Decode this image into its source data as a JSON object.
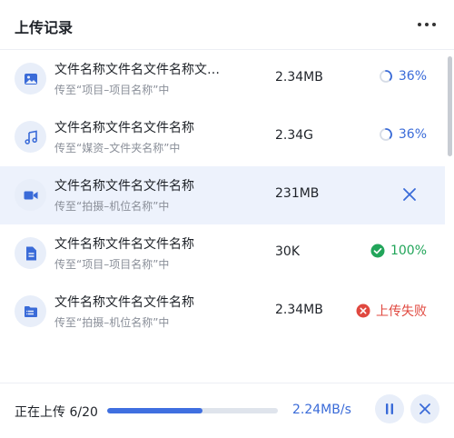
{
  "header": {
    "title": "上传记录",
    "menu_icon": "more-horizontal-icon"
  },
  "files": [
    {
      "name": "文件名称文件名文件名称文…",
      "dest": "传至“项目–项目名称”中",
      "size": "2.34MB",
      "type_icon": "image-icon",
      "state": "uploading",
      "status_text": "36%",
      "progress": 0.36
    },
    {
      "name": "文件名称文件名文件名称",
      "dest": "传至“媒资–文件夹名称”中",
      "size": "2.34G",
      "type_icon": "music-icon",
      "state": "uploading",
      "status_text": "36%",
      "progress": 0.36
    },
    {
      "name": "文件名称文件名文件名称",
      "dest": "传至“拍摄–机位名称”中",
      "size": "231MB",
      "type_icon": "video-icon",
      "state": "selected",
      "status_text": ""
    },
    {
      "name": "文件名称文件名文件名称",
      "dest": "传至“项目–项目名称”中",
      "size": "30K",
      "type_icon": "document-icon",
      "state": "done",
      "status_text": "100%"
    },
    {
      "name": "文件名称文件名文件名称",
      "dest": "传至“拍摄–机位名称”中",
      "size": "2.34MB",
      "type_icon": "folder-list-icon",
      "state": "failed",
      "status_text": "上传失败"
    }
  ],
  "footer": {
    "label": "正在上传 6/20",
    "progress": 0.56,
    "speed": "2.24MB/s",
    "pause_icon": "pause-icon",
    "cancel_icon": "close-icon"
  },
  "colors": {
    "accent": "#3f6fe0",
    "success": "#22a55a",
    "error": "#e0483f",
    "icon_bg": "#e8eef9",
    "selected_bg": "#edf2fc"
  }
}
